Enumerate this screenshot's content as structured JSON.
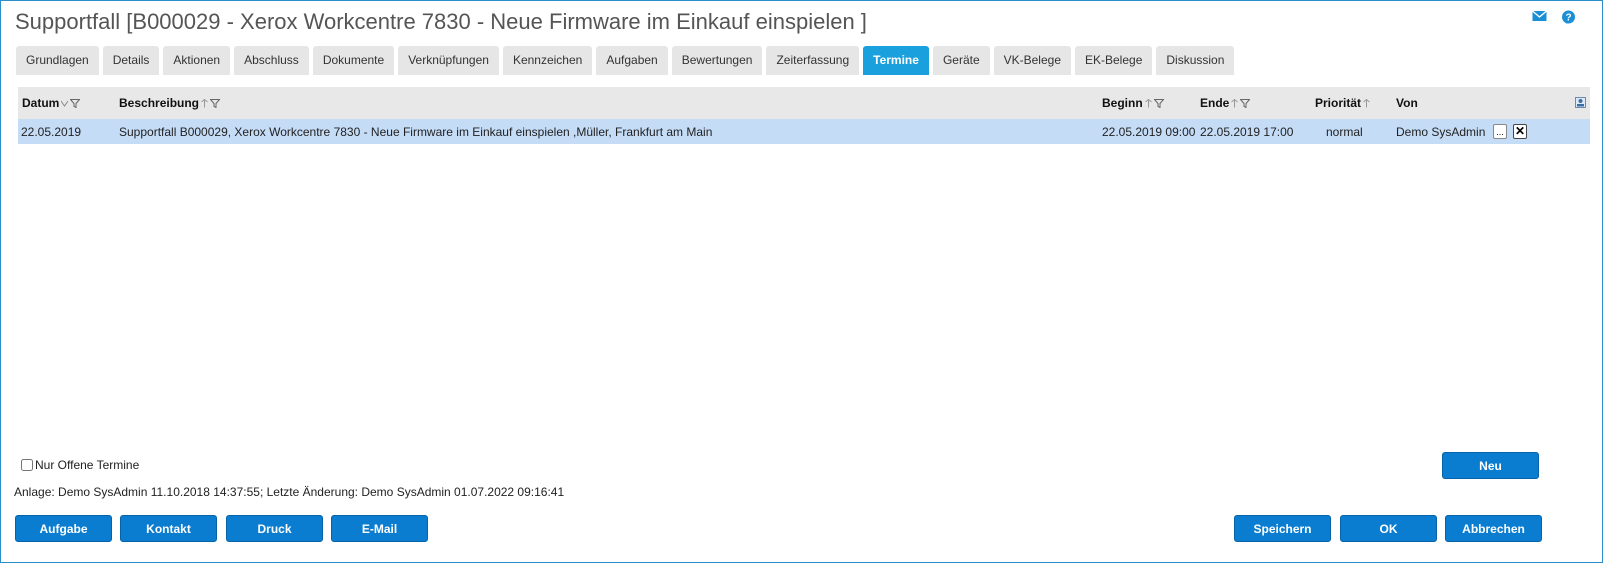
{
  "window": {
    "title": "Supportfall [B000029 - Xerox Workcentre 7830 - Neue Firmware im Einkauf einspielen ]",
    "accent_color": "#1aa0dc",
    "icons": [
      "mail-icon",
      "help-icon"
    ]
  },
  "tabs": [
    {
      "label": "Grundlagen"
    },
    {
      "label": "Details"
    },
    {
      "label": "Aktionen"
    },
    {
      "label": "Abschluss"
    },
    {
      "label": "Dokumente"
    },
    {
      "label": "Verknüpfungen"
    },
    {
      "label": "Kennzeichen"
    },
    {
      "label": "Aufgaben"
    },
    {
      "label": "Bewertungen"
    },
    {
      "label": "Zeiterfassung"
    },
    {
      "label": "Termine",
      "active": true
    },
    {
      "label": "Geräte"
    },
    {
      "label": "VK-Belege"
    },
    {
      "label": "EK-Belege"
    },
    {
      "label": "Diskussion"
    }
  ],
  "grid": {
    "columns": {
      "datum": "Datum",
      "beschreibung": "Beschreibung",
      "beginn": "Beginn",
      "ende": "Ende",
      "prioritaet": "Priorität",
      "von": "Von"
    },
    "rows": [
      {
        "datum": "22.05.2019",
        "beschreibung": "Supportfall B000029, Xerox Workcentre 7830 - Neue Firmware im Einkauf einspielen ,Müller, Frankfurt am Main",
        "beginn": "22.05.2019 09:00",
        "ende": "22.05.2019 17:00",
        "prioritaet": "normal",
        "von": "Demo SysAdmin",
        "edit_label": "...",
        "delete_label": "✕"
      }
    ],
    "selected_row_color": "#c5dcf7"
  },
  "filter": {
    "label": "Nur Offene Termine",
    "checked": false
  },
  "audit": {
    "text": "Anlage: Demo SysAdmin 11.10.2018 14:37:55; Letzte Änderung: Demo SysAdmin 01.07.2022 09:16:41"
  },
  "buttons": {
    "neu": "Neu",
    "aufgabe": "Aufgabe",
    "kontakt": "Kontakt",
    "druck": "Druck",
    "email": "E-Mail",
    "speichern": "Speichern",
    "ok": "OK",
    "abbrechen": "Abbrechen"
  }
}
